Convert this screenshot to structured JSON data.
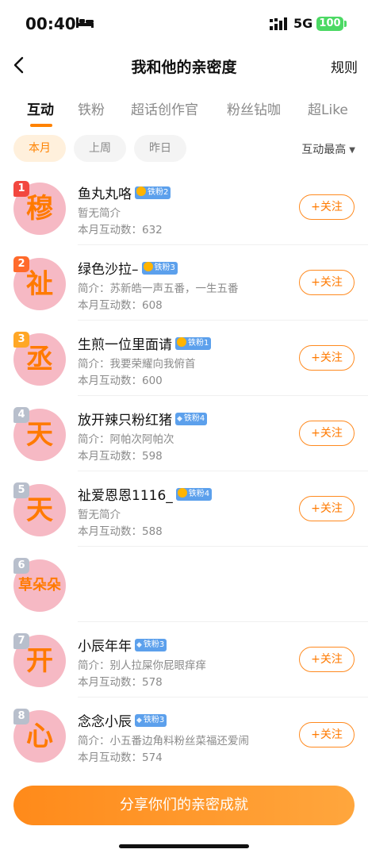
{
  "status": {
    "time": "00:40",
    "network": "5G",
    "battery": "100"
  },
  "nav": {
    "title": "我和他的亲密度",
    "rule": "规则"
  },
  "tabs": [
    {
      "label": "互动",
      "active": true
    },
    {
      "label": "铁粉"
    },
    {
      "label": "超话创作官"
    },
    {
      "label": "粉丝钻咖"
    },
    {
      "label": "超Like"
    }
  ],
  "filters": [
    {
      "label": "本月",
      "active": true
    },
    {
      "label": "上周"
    },
    {
      "label": "昨日"
    }
  ],
  "sort": {
    "label": "互动最高"
  },
  "follow_label": "+关注",
  "rows": [
    {
      "rank": "1",
      "rank_color": "#f2473f",
      "avatar_text": "穆",
      "name": "鱼丸丸咯",
      "badge": "铁粉2",
      "badge_type": "emblem",
      "intro": "暂无简介",
      "count": "本月互动数：632",
      "follow": true
    },
    {
      "rank": "2",
      "rank_color": "#ff6a2b",
      "avatar_text": "祉",
      "name": "绿色沙拉–",
      "badge": "铁粉3",
      "badge_type": "emblem",
      "intro": "简介：苏新皓一声五番，一生五番",
      "count": "本月互动数：608",
      "follow": true
    },
    {
      "rank": "3",
      "rank_color": "#ffa726",
      "avatar_text": "丞",
      "name": "生煎一位里面请",
      "badge": "铁粉1",
      "badge_type": "emblem",
      "intro": "简介：我要荣耀向我俯首",
      "count": "本月互动数：600",
      "follow": true
    },
    {
      "rank": "4",
      "rank_color": "#b8bfcc",
      "avatar_text": "天",
      "name": "放开辣只粉红猪",
      "badge": "铁粉4",
      "badge_type": "diamond",
      "intro": "简介：阿帕次阿帕次",
      "count": "本月互动数：598",
      "follow": true
    },
    {
      "rank": "5",
      "rank_color": "#b8bfcc",
      "avatar_text": "天",
      "name": "祉爱恩恩1116_",
      "badge": "铁粉4",
      "badge_type": "emblem",
      "intro": "暂无简介",
      "count": "本月互动数：588",
      "follow": true
    },
    {
      "rank": "6",
      "rank_color": "#b8bfcc",
      "avatar_text": "草朵朵",
      "name": "",
      "badge": "",
      "badge_type": "",
      "intro": "",
      "count": "",
      "follow": false
    },
    {
      "rank": "7",
      "rank_color": "#b8bfcc",
      "avatar_text": "开",
      "name": "小辰年年",
      "badge": "铁粉3",
      "badge_type": "diamond",
      "intro": "简介：别人拉屎你屁眼痒痒",
      "count": "本月互动数：578",
      "follow": true
    },
    {
      "rank": "8",
      "rank_color": "#b8bfcc",
      "avatar_text": "心",
      "name": "念念小辰",
      "badge": "铁粉3",
      "badge_type": "diamond",
      "intro": "简介：小五番边角料粉丝菜福还爱闹",
      "count": "本月互动数：574",
      "follow": true
    }
  ],
  "share_button": "分享你们的亲密成就",
  "colors": {
    "accent": "#ff8200",
    "avatar_bg": "#f6b9c4",
    "badge_bg": "#5ca0ec"
  }
}
